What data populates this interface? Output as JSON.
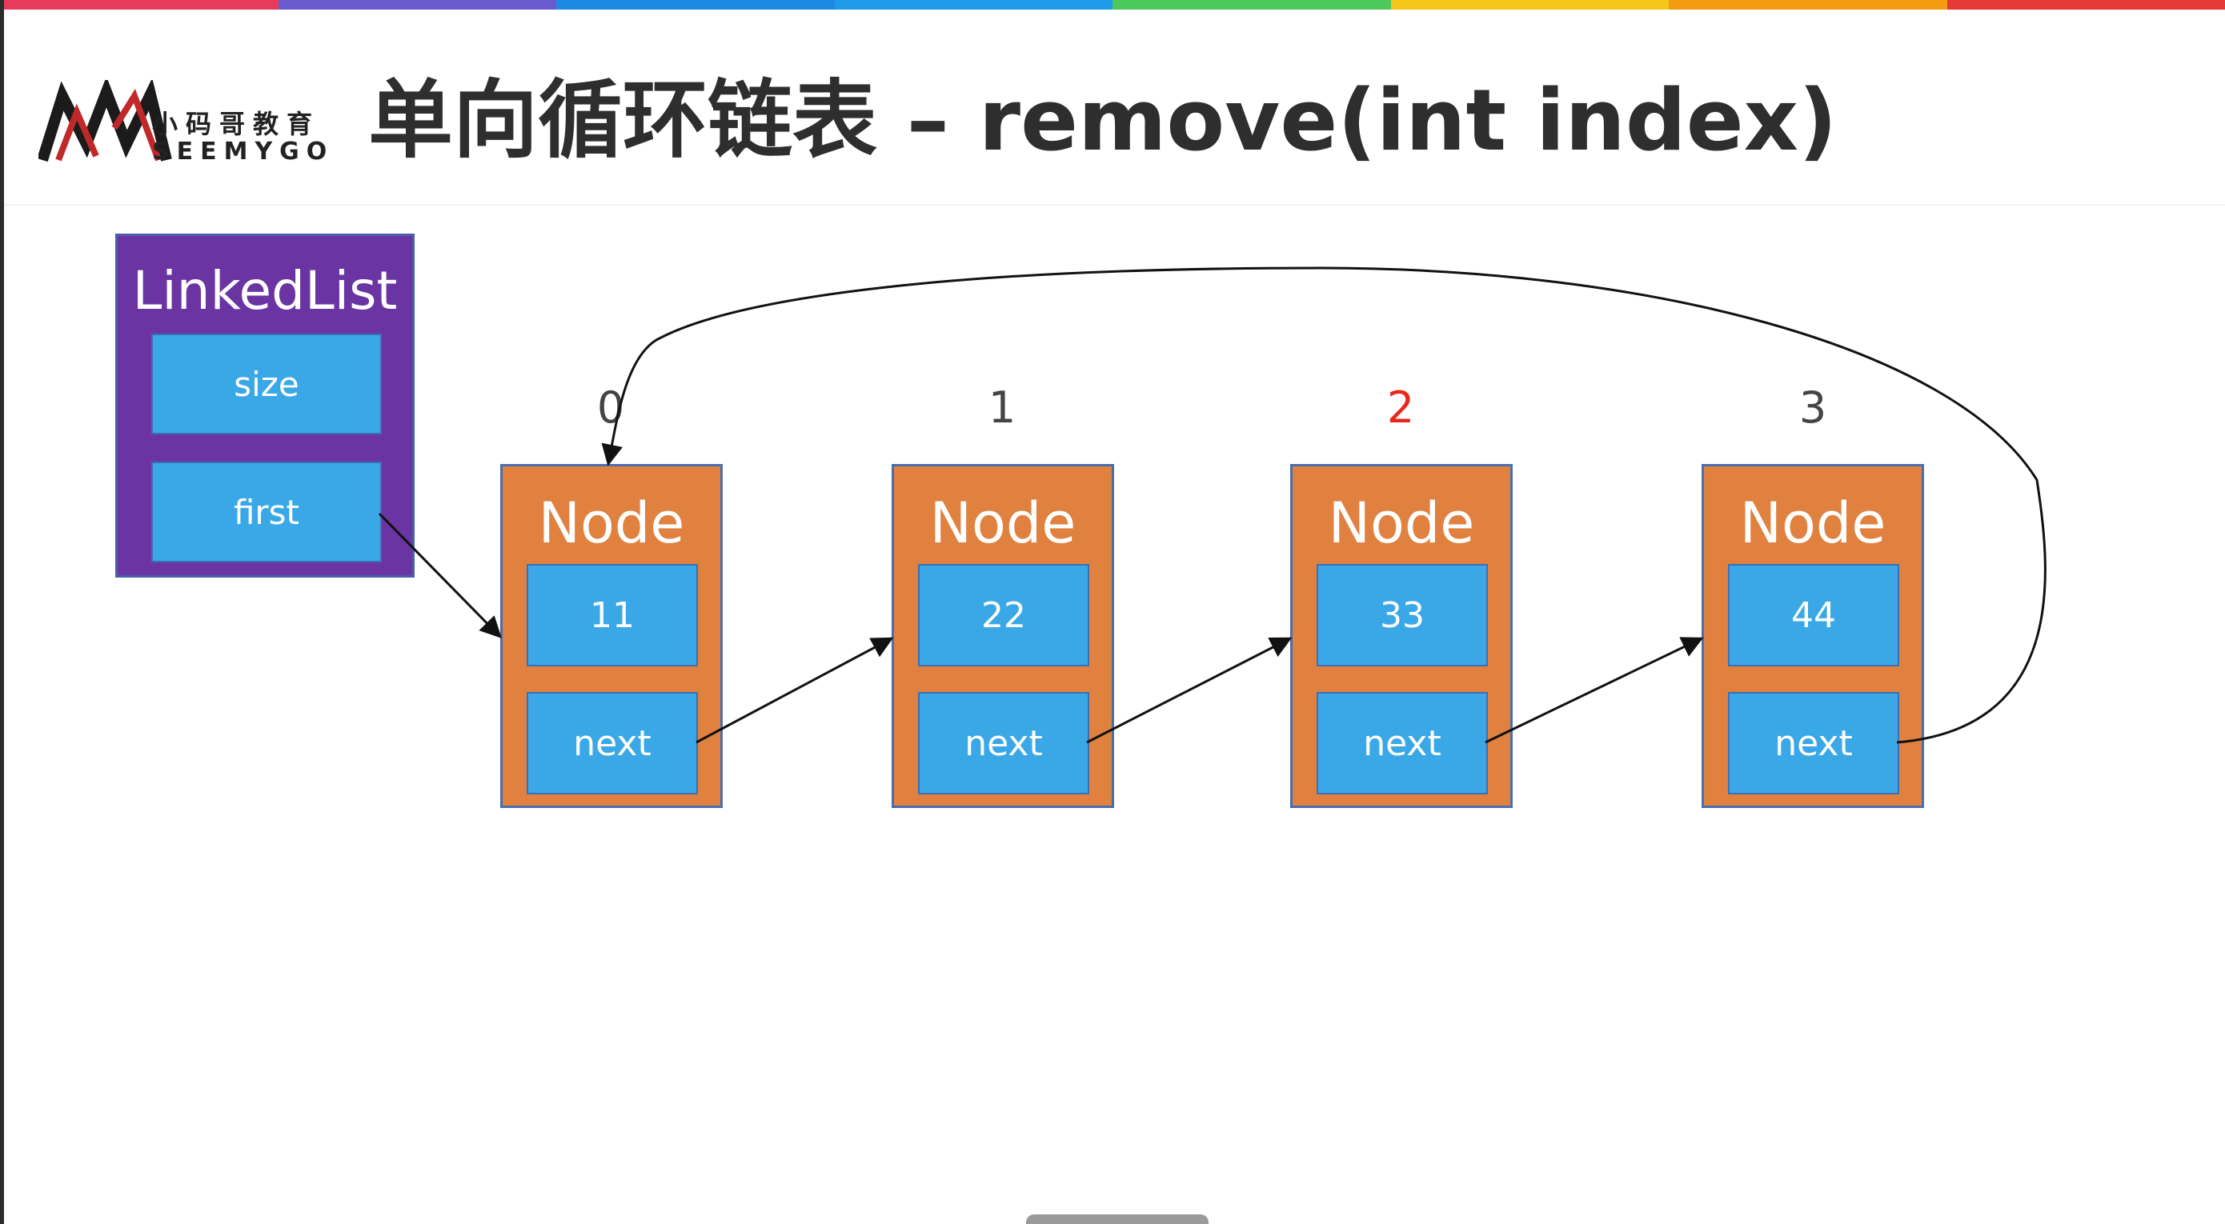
{
  "header": {
    "title": "单向循环链表 – remove(int index)",
    "logo_cn": "小码哥教育",
    "logo_en": "SEEMYGO"
  },
  "colors": {
    "top_bar": [
      "#e63b5a",
      "#6a5acd",
      "#1e88e5",
      "#1e9be8",
      "#4cc95a",
      "#f5c518",
      "#f39c12",
      "#e53935"
    ],
    "linkedlist_fill": "#6a35a2",
    "node_fill": "#e0813f",
    "field_fill": "#3aa8e6",
    "highlight_index": "#e8271c"
  },
  "diagram": {
    "linked_list": {
      "title": "LinkedList",
      "fields": [
        "size",
        "first"
      ]
    },
    "nodes": [
      {
        "index": "0",
        "title": "Node",
        "value": "11",
        "next_label": "next",
        "highlight": false
      },
      {
        "index": "1",
        "title": "Node",
        "value": "22",
        "next_label": "next",
        "highlight": false
      },
      {
        "index": "2",
        "title": "Node",
        "value": "33",
        "next_label": "next",
        "highlight": true
      },
      {
        "index": "3",
        "title": "Node",
        "value": "44",
        "next_label": "next",
        "highlight": false
      }
    ]
  }
}
